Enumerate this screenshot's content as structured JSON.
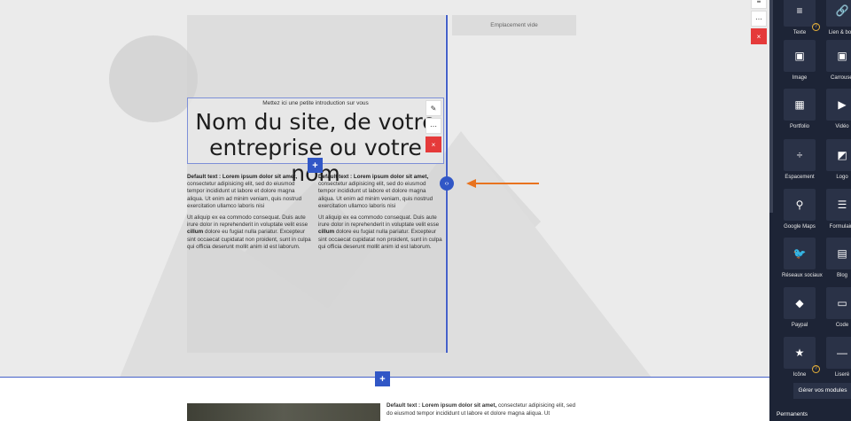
{
  "editor": {
    "empty_slot": "Emplacement vide",
    "intro": "Mettez ici une petite introduction sur vous",
    "site_title": "Nom du site, de votre entreprise ou votre nom",
    "col1_bold": "Default text : Lorem ipsum dolor sit amet,",
    "col1_p1": " consectetur adipisicing elit, sed do eiusmod tempor incididunt ut labore et dolore magna aliqua. Ut enim ad minim veniam, quis nostrud exercitation ullamco laboris nisi",
    "col1_p2a": "Ut aliquip ex ea commodo consequat. Duis aute irure dolor in reprehenderit in voluptate velit esse ",
    "col1_p2b": "cillum",
    "col1_p2c": " dolore eu fugiat nulla pariatur. Excepteur sint occaecat cupidatat non proident, sunt in culpa qui officia deserunt mollit anim id est laborum.",
    "col2_bold": "Default text : Lorem ipsum dolor sit amet,",
    "col2_p1": " consectetur adipisicing elit, sed do eiusmod tempor incididunt ut labore et dolore magna aliqua. Ut enim ad minim veniam, quis nostrud exercitation ullamco laboris nisi",
    "col2_p2a": "Ut aliquip ex ea commodo consequat. Duis aute irure dolor in reprehenderit in voluptate velit esse ",
    "col2_p2b": "cillum",
    "col2_p2c": " dolore eu fugiat nulla pariatur. Excepteur sint occaecat cupidatat non proident, sunt in culpa qui officia deserunt mollit anim id est laborum.",
    "bottom_bold": "Default text : Lorem ipsum dolor sit amet,",
    "bottom_text": " consectetur adipisicing elit, sed do eiusmod tempor incididunt ut labore et dolore magna aliqua. Ut"
  },
  "icons": {
    "pencil": "✎",
    "more": "⋯",
    "close": "×",
    "add": "+",
    "resize": "‹›",
    "menu": "≡"
  },
  "sidebar": {
    "modules": [
      {
        "label": "Texte",
        "icon": "≡",
        "badge": "?"
      },
      {
        "label": "Lien & bout",
        "icon": "🔗"
      },
      {
        "label": "Image",
        "icon": "▣"
      },
      {
        "label": "Carrousel",
        "icon": "▣",
        "badge": "?"
      },
      {
        "label": "Portfolio",
        "icon": "▦"
      },
      {
        "label": "Vidéo",
        "icon": "▶"
      },
      {
        "label": "Espacement",
        "icon": "÷"
      },
      {
        "label": "Logo",
        "icon": "◩"
      },
      {
        "label": "Google Maps",
        "icon": "⚲"
      },
      {
        "label": "Formulaire",
        "icon": "☰"
      },
      {
        "label": "Réseaux sociaux",
        "icon": "🐦"
      },
      {
        "label": "Blog",
        "icon": "▤"
      },
      {
        "label": "Paypal",
        "icon": "◆"
      },
      {
        "label": "Code",
        "icon": "▭"
      },
      {
        "label": "Icône",
        "icon": "★",
        "badge": "?"
      },
      {
        "label": "Liseré",
        "icon": "—"
      }
    ],
    "manage_label": "Gérer vos modules",
    "permanents_label": "Permanents"
  },
  "colors": {
    "accent": "#3157c6",
    "danger": "#e53a3a",
    "arrow": "#e8731f",
    "sidebar": "#1d2436"
  }
}
